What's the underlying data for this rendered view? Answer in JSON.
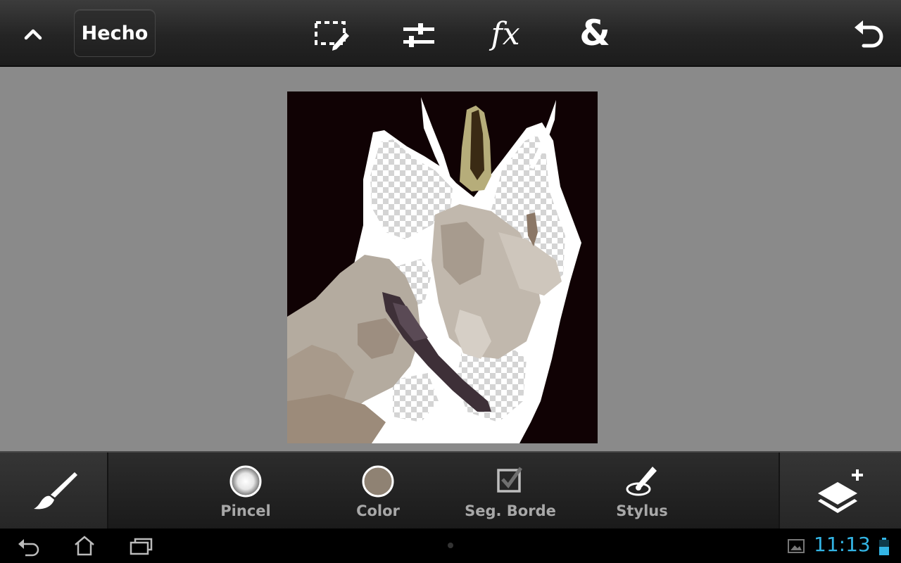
{
  "toolbar": {
    "collapse_icon": "chevron-up-icon",
    "done_label": "Hecho",
    "tools": [
      "selection-edit-icon",
      "adjustments-icon",
      "fx-icon",
      "ampersand-icon"
    ],
    "fx_label": "fx",
    "ampersand_label": "&",
    "undo_icon": "undo-icon"
  },
  "bottom_tools": {
    "brush_icon": "paintbrush-icon",
    "items": [
      {
        "label": "Pincel",
        "icon": "brush-preview-icon"
      },
      {
        "label": "Color",
        "icon": "color-swatch-icon",
        "color": "#8f8273"
      },
      {
        "label": "Seg. Borde",
        "icon": "checkbox-icon"
      },
      {
        "label": "Stylus",
        "icon": "stylus-icon"
      }
    ],
    "layers_icon": "add-layer-icon"
  },
  "system_bar": {
    "time": "11:13",
    "clock_color": "#33b5e5"
  }
}
